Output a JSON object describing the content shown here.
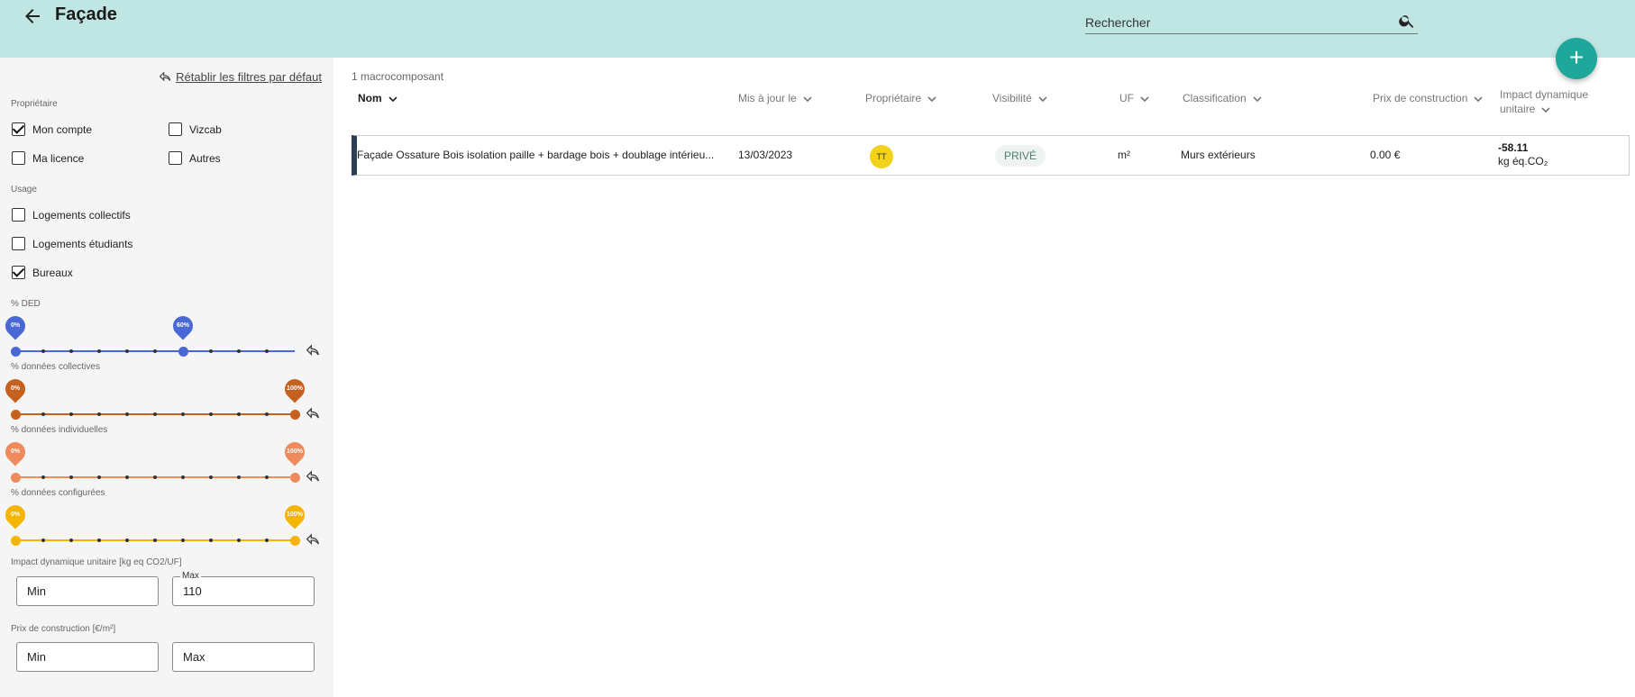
{
  "header": {
    "title": "Façade",
    "search_placeholder": "Rechercher"
  },
  "sidebar": {
    "reset_label": " Rétablir les filtres par défaut",
    "owner_section": "Propriétaire",
    "owner_options": [
      {
        "label": "Mon compte",
        "checked": true
      },
      {
        "label": "Vizcab",
        "checked": false
      },
      {
        "label": "Ma licence",
        "checked": false
      },
      {
        "label": "Autres",
        "checked": false
      }
    ],
    "usage_section": "Usage",
    "usage_options": [
      {
        "label": "Logements collectifs",
        "checked": false
      },
      {
        "label": "Logements étudiants",
        "checked": false
      },
      {
        "label": "Bureaux",
        "checked": true
      }
    ],
    "sliders": [
      {
        "label": "% DED",
        "min": "0%",
        "max": "60%",
        "min_value": 0,
        "max_value": 60,
        "color": "#4a67d6"
      },
      {
        "label": "% données collectives",
        "min": "0%",
        "max": "100%",
        "min_value": 0,
        "max_value": 100,
        "color": "#c5601e"
      },
      {
        "label": "% données individuelles",
        "min": "0%",
        "max": "100%",
        "min_value": 0,
        "max_value": 100,
        "color": "#ee8a5c"
      },
      {
        "label": "% données configurées",
        "min": "0%",
        "max": "100%",
        "min_value": 0,
        "max_value": 100,
        "color": "#f5b400"
      }
    ],
    "impact_section": "Impact dynamique unitaire [kg eq CO2/UF]",
    "impact_min_placeholder": "Min",
    "impact_max_label": "Max",
    "impact_max_value": "110",
    "price_section": "Prix de construction [€/m²]",
    "price_min_placeholder": "Min",
    "price_max_placeholder": "Max"
  },
  "main": {
    "count": "1 macrocomposant",
    "columns": {
      "nom": "Nom",
      "updated": "Mis à jour le",
      "owner": "Propriétaire",
      "visibility": "Visibilité",
      "uf": "UF",
      "classification": "Classification",
      "price": "Prix de construction",
      "impact_line1": "Impact dynamique",
      "impact_line2": "unitaire"
    },
    "rows": [
      {
        "name": "Façade Ossature Bois isolation paille + bardage bois + doublage intérieu...",
        "date": "13/03/2023",
        "owner_initials": "TT",
        "visibility": "PRIVÉ",
        "uf": "m²",
        "classification": "Murs extérieurs",
        "price": "0.00 €",
        "impact_value": "-58.11",
        "impact_unit": "kg éq.CO₂"
      }
    ]
  },
  "colors": {
    "header_bg": "#bfe6e3",
    "fab": "#1fa79c",
    "row_accent": "#2c3e50",
    "avatar": "#f2d21b"
  }
}
